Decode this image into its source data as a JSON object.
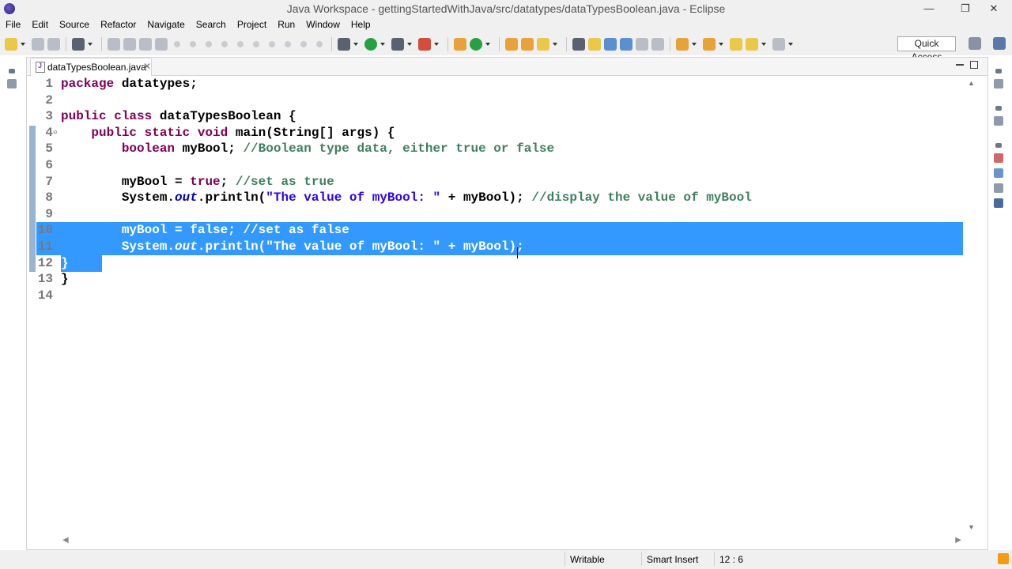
{
  "window": {
    "title": "Java Workspace - gettingStartedWithJava/src/datatypes/dataTypesBoolean.java - Eclipse",
    "minimize_glyph": "—",
    "restore_glyph": "❐",
    "close_glyph": "✕"
  },
  "menu": [
    "File",
    "Edit",
    "Source",
    "Refactor",
    "Navigate",
    "Search",
    "Project",
    "Run",
    "Window",
    "Help"
  ],
  "toolbar": {
    "quick_access": "Quick Access"
  },
  "editor": {
    "tab_label": "dataTypesBoolean.java",
    "tab_close": "✕",
    "lines": [
      {
        "num": "1",
        "code": "package datatypes;"
      },
      {
        "num": "2",
        "code": ""
      },
      {
        "num": "3",
        "code": "public class dataTypesBoolean {"
      },
      {
        "num": "4",
        "code": "    public static void main(String[] args) {"
      },
      {
        "num": "5",
        "code": "        boolean myBool; //Boolean type data, either true or false"
      },
      {
        "num": "6",
        "code": ""
      },
      {
        "num": "7",
        "code": "        myBool = true; //set as true"
      },
      {
        "num": "8",
        "code": "        System.out.println(\"The value of myBool: \" + myBool); //display the value of myBool"
      },
      {
        "num": "9",
        "code": ""
      },
      {
        "num": "10",
        "code": "        myBool = false; //set as false"
      },
      {
        "num": "11",
        "code": "        System.out.println(\"The value of myBool: \" + myBool);"
      },
      {
        "num": "12",
        "code": "    }"
      },
      {
        "num": "13",
        "code": "}"
      },
      {
        "num": "14",
        "code": ""
      }
    ],
    "selected_lines": [
      10,
      11,
      12
    ],
    "selection_color": "#3399ff",
    "colors": {
      "keyword": "#7f0055",
      "string": "#2a00ff",
      "comment": "#3f7f5f",
      "field": "#0000c0"
    }
  },
  "status": {
    "writable": "Writable",
    "insert_mode": "Smart Insert",
    "position": "12 : 6"
  },
  "icons": [
    "app-eclipse-icon",
    "new-icon",
    "save-icon",
    "save-all-icon",
    "debug-icon",
    "run-icon",
    "coverage-icon",
    "external-tools-icon",
    "new-java-project-icon",
    "new-package-icon",
    "new-class-icon",
    "open-type-icon",
    "search-icon",
    "toggle-mark-occurrences-icon",
    "next-annotation-icon",
    "previous-annotation-icon",
    "back-icon",
    "forward-icon",
    "perspective-java-icon",
    "minimize-icon",
    "maximize-icon",
    "rss-icon"
  ]
}
